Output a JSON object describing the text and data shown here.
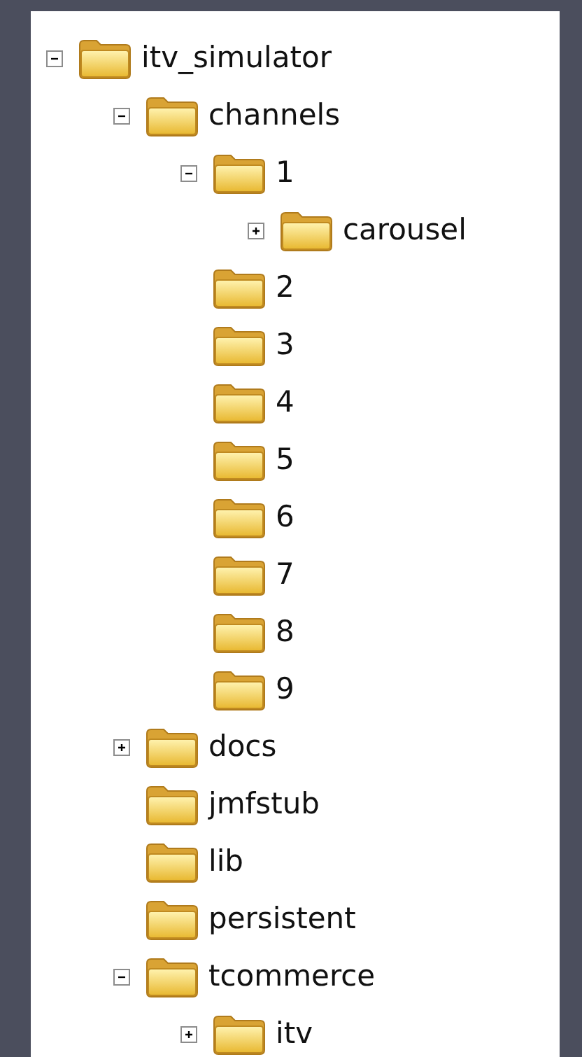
{
  "tree": [
    {
      "name": "itv_simulator",
      "kind": "branch",
      "expanded": true,
      "children": [
        {
          "name": "channels",
          "kind": "branch",
          "expanded": true,
          "children": [
            {
              "name": "1",
              "kind": "branch",
              "expanded": true,
              "children": [
                {
                  "name": "carousel",
                  "kind": "branch",
                  "expanded": false
                }
              ]
            },
            {
              "name": "2",
              "kind": "leaf"
            },
            {
              "name": "3",
              "kind": "leaf"
            },
            {
              "name": "4",
              "kind": "leaf"
            },
            {
              "name": "5",
              "kind": "leaf"
            },
            {
              "name": "6",
              "kind": "leaf"
            },
            {
              "name": "7",
              "kind": "leaf"
            },
            {
              "name": "8",
              "kind": "leaf"
            },
            {
              "name": "9",
              "kind": "leaf"
            }
          ]
        },
        {
          "name": "docs",
          "kind": "branch",
          "expanded": false
        },
        {
          "name": "jmfstub",
          "kind": "leaf"
        },
        {
          "name": "lib",
          "kind": "leaf"
        },
        {
          "name": "persistent",
          "kind": "leaf"
        },
        {
          "name": "tcommerce",
          "kind": "branch",
          "expanded": true,
          "children": [
            {
              "name": "itv",
              "kind": "branch",
              "expanded": false
            }
          ]
        }
      ]
    }
  ]
}
